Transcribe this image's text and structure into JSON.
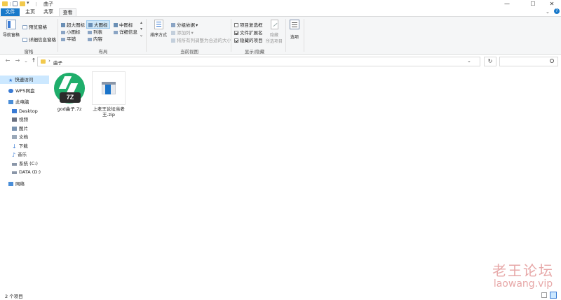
{
  "titlebar": {
    "title": "曲子",
    "minimize_glyph": "—",
    "maximize_glyph": "☐",
    "close_glyph": "✕",
    "dropdown_glyph": "▾"
  },
  "tabs": {
    "file": "文件",
    "home": "主页",
    "share": "共享",
    "view": "查看"
  },
  "ribbon": {
    "panes": {
      "label": "窗格",
      "nav_pane": "导航窗格",
      "preview_pane": "预览窗格",
      "details_pane": "详细信息窗格"
    },
    "layout": {
      "label": "布局",
      "extra_large": "超大图标",
      "large": "大图标",
      "medium": "中图标",
      "small": "小图标",
      "list": "列表",
      "details": "详细信息",
      "tiles": "平铺",
      "content": "内容"
    },
    "current_view": {
      "label": "当前视图",
      "sort_by": "排序方式",
      "group_by": "分组依据",
      "add_columns": "添加列",
      "size_columns": "将所有列调整为合适的大小"
    },
    "show_hide": {
      "label": "显示/隐藏",
      "item_checkboxes": "项目复选框",
      "file_extensions": "文件扩展名",
      "hidden_items": "隐藏的项目",
      "hide_selected": "隐藏",
      "hide_selected_2": "所选项目"
    },
    "options": {
      "label": "选项"
    },
    "checkboxes": {
      "item_checkboxes": false,
      "file_extensions": true,
      "hidden_items": true
    }
  },
  "addressbar": {
    "back": "←",
    "forward": "→",
    "recent": "⌄",
    "up": "↑",
    "chevron": "›",
    "path": "曲子",
    "dropdown": "⌄",
    "refresh": "↻",
    "search_placeholder": ""
  },
  "sidebar": {
    "quick_access": "快速访问",
    "wps": "WPS网盘",
    "this_pc": "此电脑",
    "desktop": "Desktop",
    "videos": "视频",
    "pictures": "图片",
    "documents": "文档",
    "downloads": "下载",
    "music": "音乐",
    "system_c": "系统 (C:)",
    "data_d": "DATA (D:)",
    "network": "网络"
  },
  "files": [
    {
      "name": "god曲子.7z",
      "badge": "7Z",
      "type": "7z-archive"
    },
    {
      "name": "上老王论坛当老王.zip",
      "type": "zip-archive"
    }
  ],
  "statusbar": {
    "count": "2 个项目"
  },
  "watermark": {
    "line1": "老王论坛",
    "line2": "laowang.vip"
  },
  "colors": {
    "accent": "#1979ca",
    "selection": "#cce8ff",
    "archive_green": "#1fae6b",
    "archive_dark": "#2b2b2b"
  }
}
